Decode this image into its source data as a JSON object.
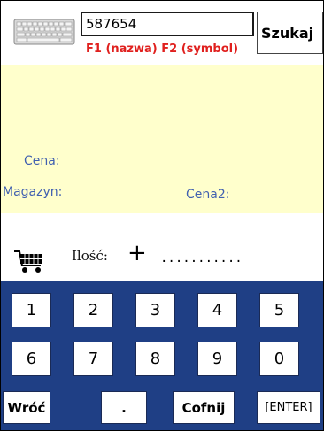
{
  "search": {
    "value": "587654",
    "button_label": "Szukaj",
    "hint": "F1 (nazwa)  F2 (symbol)"
  },
  "info": {
    "cena_label": "Cena:",
    "magazyn_label": "Magazyn:",
    "cena2_label": "Cena2:"
  },
  "quantity": {
    "label": "Ilość:",
    "plus": "+",
    "value": "..............."
  },
  "keypad": {
    "row1": [
      "1",
      "2",
      "3",
      "4",
      "5"
    ],
    "row2": [
      "6",
      "7",
      "8",
      "9",
      "0"
    ],
    "back_label": "Wróć",
    "dot_label": ".",
    "undo_label": "Cofnij",
    "enter_label": "[ENTER]"
  },
  "icons": {
    "keyboard": "keyboard-icon",
    "cart": "cart-icon"
  },
  "colors": {
    "hint": "#e0201e",
    "label": "#4060b0",
    "info_bg": "#ffffcc",
    "keypad_bg": "#1f3f85"
  }
}
